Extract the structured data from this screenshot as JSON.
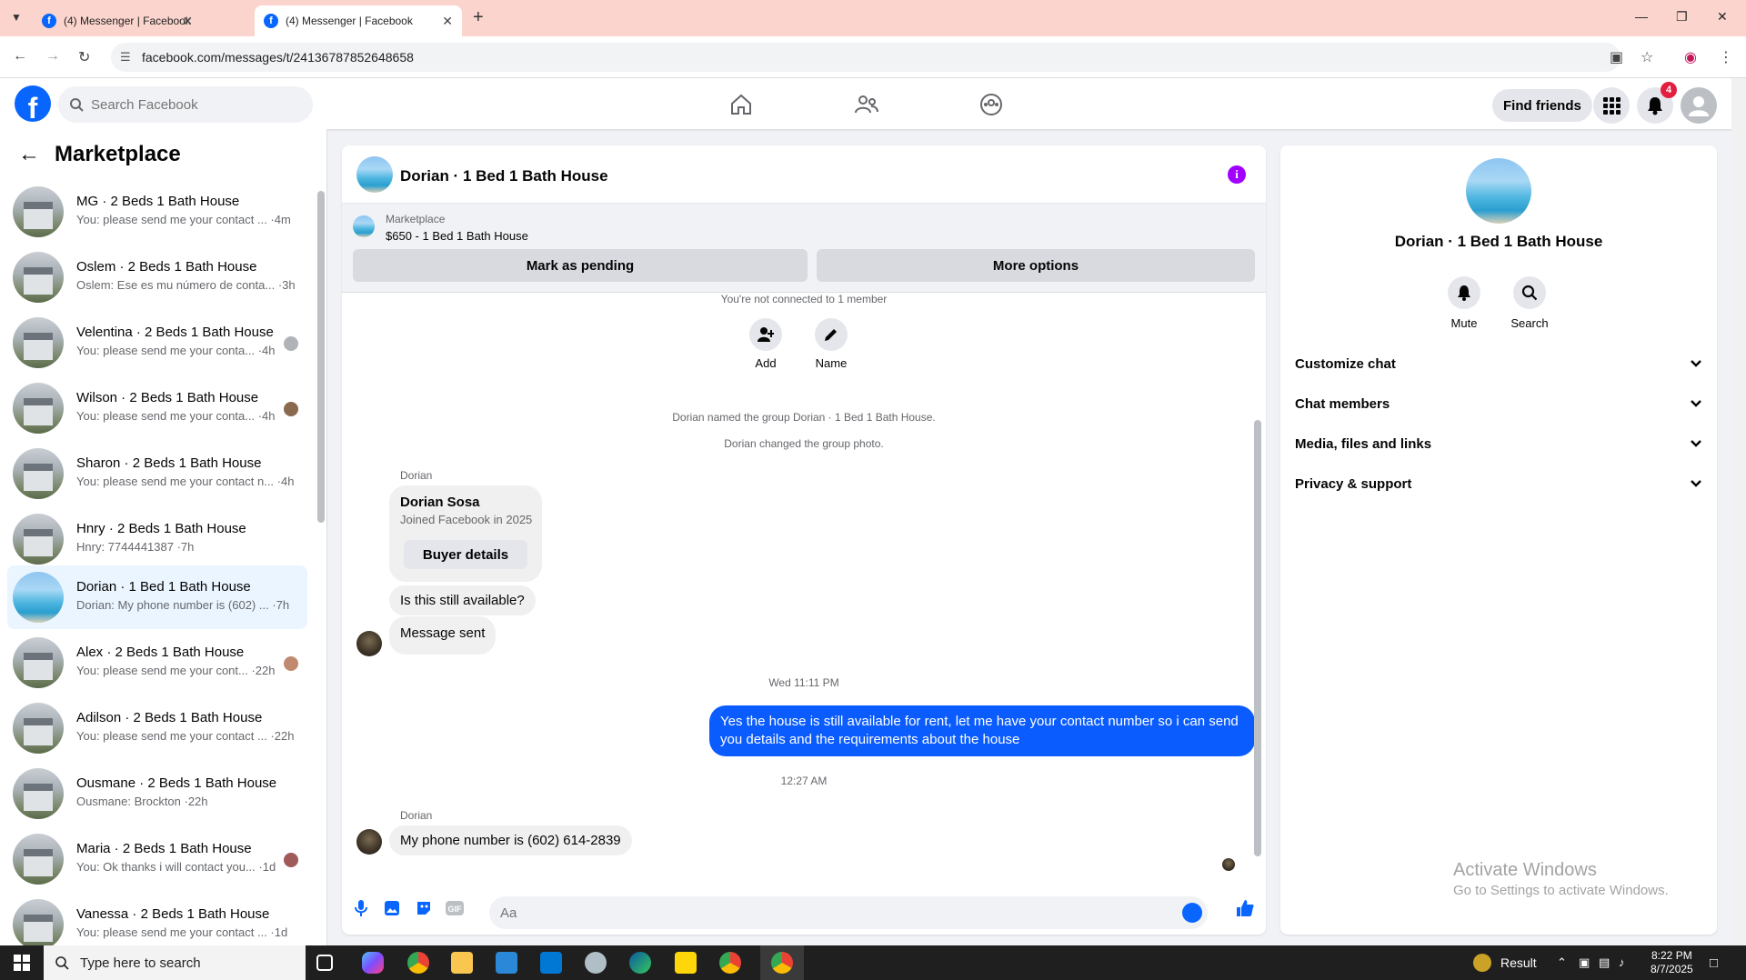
{
  "browser": {
    "tabs": [
      {
        "title": "(4) Messenger | Facebook"
      },
      {
        "title": "(4) Messenger | Facebook"
      }
    ],
    "url": "facebook.com/messages/t/24136787852648658"
  },
  "header": {
    "logo": "f",
    "search_placeholder": "Search Facebook",
    "find_friends": "Find friends",
    "notification_count": "4"
  },
  "sidebar": {
    "title": "Marketplace",
    "conversations": [
      {
        "title": "MG · 2 Beds 1 Bath House",
        "preview": "You: please send me your contact ... ·4m"
      },
      {
        "title": "Oslem · 2 Beds 1 Bath House",
        "preview": "Oslem: Ese es mu número de conta... ·3h"
      },
      {
        "title": "Velentina · 2 Beds 1 Bath House",
        "preview": "You: please send me your conta... ·4h"
      },
      {
        "title": "Wilson · 2 Beds 1 Bath House",
        "preview": "You: please send me your conta... ·4h"
      },
      {
        "title": "Sharon · 2 Beds 1 Bath House",
        "preview": "You: please send me your contact n... ·4h"
      },
      {
        "title": "Hnry · 2 Beds 1 Bath House",
        "preview": "Hnry: 7744441387 ·7h"
      },
      {
        "title": "Dorian · 1 Bed 1 Bath House",
        "preview": "Dorian: My phone number is (602) ... ·7h"
      },
      {
        "title": "Alex · 2 Beds 1 Bath House",
        "preview": "You: please send me your cont... ·22h"
      },
      {
        "title": "Adilson · 2 Beds 1 Bath House",
        "preview": "You: please send me your contact ... ·22h"
      },
      {
        "title": "Ousmane · 2 Beds 1 Bath House",
        "preview": "Ousmane: Brockton ·22h"
      },
      {
        "title": "Maria · 2 Beds 1 Bath House",
        "preview": "You: Ok thanks i will contact you... ·1d"
      },
      {
        "title": "Vanessa · 2 Beds 1 Bath House",
        "preview": "You: please send me your contact ... ·1d"
      }
    ]
  },
  "chat": {
    "title": "Dorian · 1 Bed 1 Bath House",
    "marketplace_label": "Marketplace",
    "listing": "$650 - 1 Bed 1 Bath House",
    "mark_pending": "Mark as pending",
    "more_options": "More options",
    "not_connected": "You're not connected to 1 member",
    "add_label": "Add",
    "name_label": "Name",
    "note_named": "Dorian named the group Dorian · 1 Bed 1 Bath House.",
    "note_photo": "Dorian changed the group photo.",
    "sender": "Dorian",
    "profile_name": "Dorian Sosa",
    "profile_sub": "Joined Facebook in 2025",
    "buyer_details": "Buyer details",
    "msg_available": "Is this still available?",
    "msg_sent": "Message sent",
    "time_wed": "Wed 11:11 PM",
    "my_reply": "Yes the house is still available for rent, let me have your contact number so i can send you details and the requirements about the house",
    "time_1227": "12:27 AM",
    "msg_phone": "My phone number is (602) 614-2839",
    "composer_placeholder": "Aa"
  },
  "info_panel": {
    "name": "Dorian · 1 Bed 1 Bath House",
    "mute": "Mute",
    "search": "Search",
    "sections": [
      "Customize chat",
      "Chat members",
      "Media, files and links",
      "Privacy & support"
    ],
    "activate_title": "Activate Windows",
    "activate_sub": "Go to Settings to activate Windows."
  },
  "taskbar": {
    "search_placeholder": "Type here to search",
    "result": "Result",
    "time": "8:22 PM",
    "date": "8/7/2025"
  },
  "colors": {
    "fb_blue": "#0866ff",
    "my_bubble": "#0a5cff",
    "info_purple": "#a100ff",
    "badge_red": "#e41e3f"
  }
}
